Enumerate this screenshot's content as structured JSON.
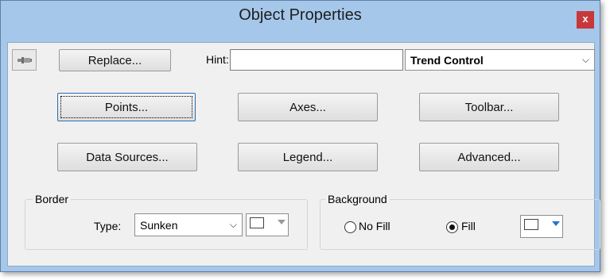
{
  "window": {
    "title": "Object Properties",
    "close_label": "x"
  },
  "toolbar": {
    "replace_label": "Replace...",
    "hint_label": "Hint:",
    "hint_value": "",
    "object_type": "Trend Control"
  },
  "buttons": {
    "points": "Points...",
    "axes": "Axes...",
    "toolbar": "Toolbar...",
    "data_sources": "Data Sources...",
    "legend": "Legend...",
    "advanced": "Advanced..."
  },
  "border": {
    "group_label": "Border",
    "type_label": "Type:",
    "type_value": "Sunken"
  },
  "background": {
    "group_label": "Background",
    "no_fill_label": "No Fill",
    "fill_label": "Fill",
    "selected": "Fill"
  }
}
